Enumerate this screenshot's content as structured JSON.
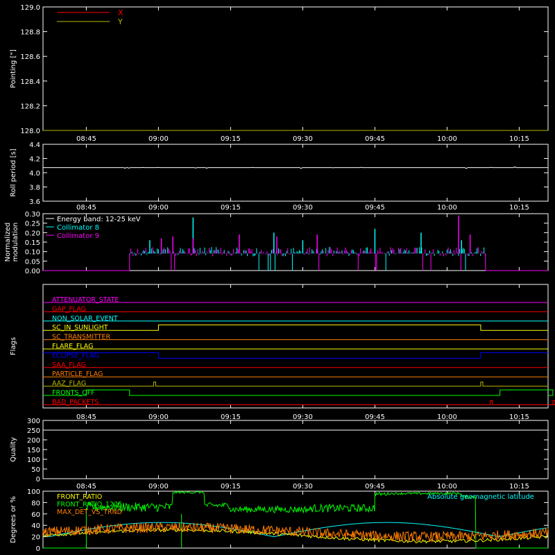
{
  "time_ticks": [
    "08:45",
    "09:00",
    "09:15",
    "09:30",
    "09:45",
    "10:00",
    "10:15"
  ],
  "chart_data": [
    {
      "id": "pointing",
      "type": "line",
      "ylabel": "Pointing [\"]",
      "ylim": [
        128.0,
        129.0
      ],
      "yticks": [
        "129.0",
        "128.8",
        "128.6",
        "128.4",
        "128.2",
        "128.0"
      ],
      "legend": [
        {
          "name": "X",
          "color": "#ff0000"
        },
        {
          "name": "Y",
          "color": "#b8b800"
        }
      ],
      "series": []
    },
    {
      "id": "roll",
      "type": "line",
      "ylabel": "Roll period [s]",
      "ylim": [
        3.5,
        4.5
      ],
      "yticks": [
        "4.4",
        "4.2",
        "4.0",
        "3.8",
        "3.6"
      ],
      "series": [
        {
          "color": "#ffffff",
          "value": 4.09
        }
      ]
    },
    {
      "id": "modulation",
      "type": "bar",
      "ylabel": "Normalized modulation",
      "ylim": [
        0.0,
        0.3
      ],
      "yticks": [
        "0.30",
        "0.25",
        "0.20",
        "0.15",
        "0.10",
        "0.05",
        "0.00"
      ],
      "legend": [
        {
          "name": "Energy band: 12-25 keV",
          "color": "#ffffff"
        },
        {
          "name": "Collimator 8",
          "color": "#00ffff"
        },
        {
          "name": "Collimator 9",
          "color": "#ff00ff"
        }
      ],
      "active_range": [
        "08:54",
        "10:08"
      ],
      "baseline": 0.09,
      "spikes_c8": [
        [
          8.97,
          0.16
        ],
        [
          9.12,
          0.28
        ],
        [
          9.4,
          0.2
        ],
        [
          9.5,
          0.16
        ],
        [
          9.75,
          0.22
        ],
        [
          9.91,
          0.2
        ],
        [
          10.05,
          0.16
        ]
      ],
      "spikes_c9": [
        [
          9.01,
          0.17
        ],
        [
          9.05,
          0.18
        ],
        [
          9.12,
          0.17
        ],
        [
          9.28,
          0.19
        ],
        [
          9.41,
          0.18
        ],
        [
          9.55,
          0.19
        ],
        [
          10.04,
          0.29
        ],
        [
          10.08,
          0.19
        ]
      ]
    },
    {
      "id": "flags",
      "type": "line",
      "ylabel": "Flags",
      "flags": [
        {
          "name": "ATTENUATOR_STATE",
          "color": "#ff00ff",
          "steps": []
        },
        {
          "name": "GAP_FLAG",
          "color": "#ff0000",
          "steps": []
        },
        {
          "name": "NON_SOLAR_EVENT",
          "color": "#00ffff",
          "steps": []
        },
        {
          "name": "SC_IN_SUNLIGHT",
          "color": "#ffff00",
          "steps": [
            [
              "09:00",
              "10:07"
            ]
          ]
        },
        {
          "name": "SC_TRANSMITTER",
          "color": "#ff7f00",
          "steps": []
        },
        {
          "name": "FLARE_FLAG",
          "color": "#ffff00",
          "steps": []
        },
        {
          "name": "ECLIPSE_FLAG",
          "color": "#0000ff",
          "steps": [
            [
              "09:00",
              "10:07"
            ]
          ],
          "inverted": true
        },
        {
          "name": "SAA_FLAG",
          "color": "#ff0000",
          "steps": []
        },
        {
          "name": "PARTICLE_FLAG",
          "color": "#ff7f00",
          "steps": []
        },
        {
          "name": "AAZ_FLAG",
          "color": "#b8b800",
          "steps": [
            [
              "08:59",
              "08:59"
            ],
            [
              "10:07",
              "10:07"
            ]
          ],
          "pulse": true
        },
        {
          "name": "FRONTS_OFF",
          "color": "#00ff00",
          "steps": [
            [
              "08:45",
              "08:54"
            ],
            [
              "10:11",
              "10:22"
            ]
          ]
        },
        {
          "name": "BAD_PACKETS",
          "color": "#ff0000",
          "steps": [
            [
              "10:09",
              "10:09"
            ],
            [
              "10:22",
              "10:22"
            ]
          ],
          "pulse": true
        }
      ]
    },
    {
      "id": "quality",
      "type": "line",
      "ylabel": "Quality",
      "ylim": [
        0,
        300
      ],
      "yticks": [
        "300",
        "250",
        "200",
        "150",
        "100",
        "50",
        "0"
      ],
      "series": [
        {
          "color": "#ffffff",
          "value": 300
        }
      ]
    },
    {
      "id": "degrees",
      "type": "line",
      "ylabel": "Degrees or %",
      "ylim": [
        0,
        100
      ],
      "yticks": [
        "100",
        "80",
        "60",
        "40",
        "20",
        "0"
      ],
      "legend": [
        {
          "name": "FRONT_RATIO",
          "color": "#ffff00"
        },
        {
          "name": "FRONT_RATIO_1225",
          "color": "#00ff00"
        },
        {
          "name": "MAX_DET_VS_TRND",
          "color": "#ff7f00"
        }
      ],
      "annotation": {
        "text": "Absolute geomagnetic latitude",
        "color": "#00ffff"
      },
      "front_ratio_1225_segments": [
        [
          8.75,
          9.05,
          72,
          8
        ],
        [
          9.05,
          9.16,
          98,
          2
        ],
        [
          9.16,
          9.25,
          75,
          5
        ],
        [
          9.25,
          9.53,
          68,
          6
        ],
        [
          9.53,
          9.75,
          70,
          7
        ],
        [
          9.75,
          9.8,
          95,
          3
        ],
        [
          9.8,
          10.05,
          96,
          2
        ],
        [
          10.05,
          10.1,
          90,
          3
        ]
      ]
    }
  ]
}
